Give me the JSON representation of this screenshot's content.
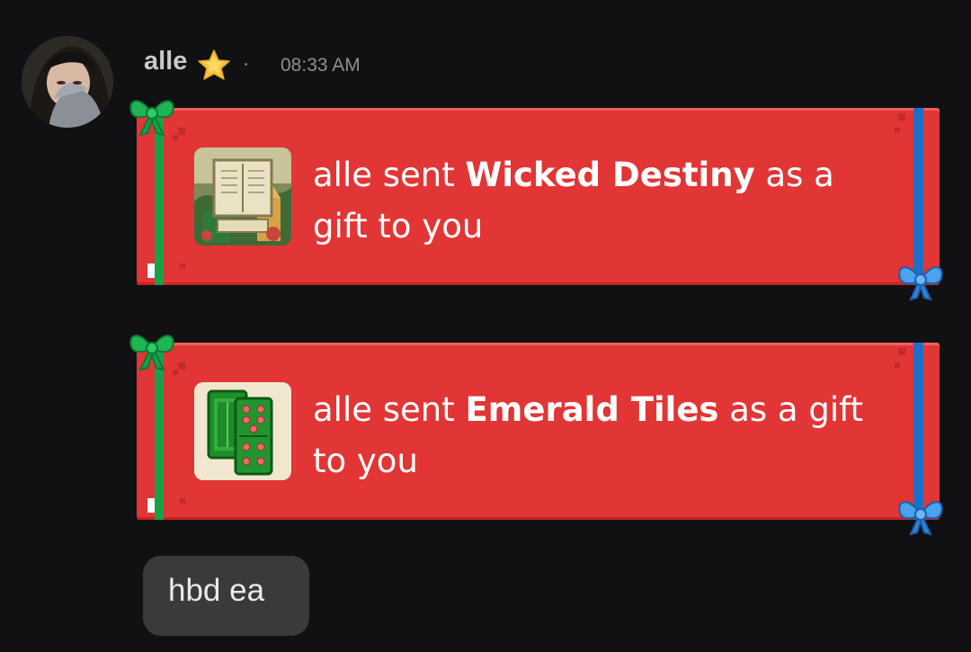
{
  "message": {
    "author": "alle",
    "badge_icon": "star-icon",
    "timestamp": "08:33 AM"
  },
  "gifts": [
    {
      "sender": "alle",
      "verb": "sent",
      "item": "Wicked Destiny",
      "suffix": "as a gift to you",
      "thumbnail_icon": "wicked-destiny-thumbnail"
    },
    {
      "sender": "alle",
      "verb": "sent",
      "item": "Emerald Tiles",
      "suffix": "as a gift to you",
      "thumbnail_icon": "emerald-tiles-thumbnail"
    }
  ],
  "reply": {
    "text": "hbd ea"
  },
  "colors": {
    "background": "#111113",
    "gift_card": "#e23535",
    "ribbon_green": "#18a14a",
    "ribbon_blue": "#1f6fc9",
    "bubble": "#3a3a3c"
  }
}
